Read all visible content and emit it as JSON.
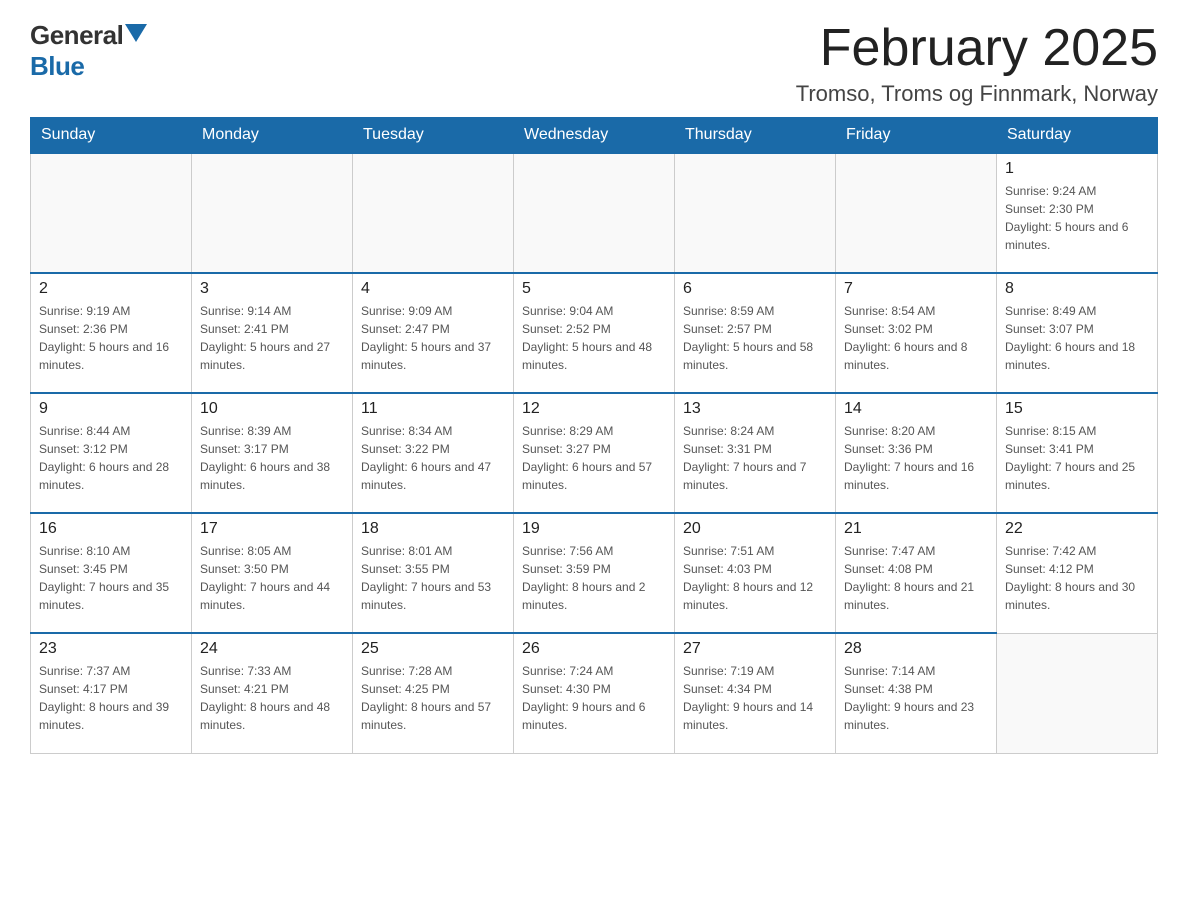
{
  "header": {
    "logo": {
      "general": "General",
      "triangle": "▶",
      "blue": "Blue"
    },
    "title": "February 2025",
    "subtitle": "Tromso, Troms og Finnmark, Norway"
  },
  "weekdays": [
    "Sunday",
    "Monday",
    "Tuesday",
    "Wednesday",
    "Thursday",
    "Friday",
    "Saturday"
  ],
  "weeks": [
    [
      {
        "day": "",
        "info": ""
      },
      {
        "day": "",
        "info": ""
      },
      {
        "day": "",
        "info": ""
      },
      {
        "day": "",
        "info": ""
      },
      {
        "day": "",
        "info": ""
      },
      {
        "day": "",
        "info": ""
      },
      {
        "day": "1",
        "info": "Sunrise: 9:24 AM\nSunset: 2:30 PM\nDaylight: 5 hours and 6 minutes."
      }
    ],
    [
      {
        "day": "2",
        "info": "Sunrise: 9:19 AM\nSunset: 2:36 PM\nDaylight: 5 hours and 16 minutes."
      },
      {
        "day": "3",
        "info": "Sunrise: 9:14 AM\nSunset: 2:41 PM\nDaylight: 5 hours and 27 minutes."
      },
      {
        "day": "4",
        "info": "Sunrise: 9:09 AM\nSunset: 2:47 PM\nDaylight: 5 hours and 37 minutes."
      },
      {
        "day": "5",
        "info": "Sunrise: 9:04 AM\nSunset: 2:52 PM\nDaylight: 5 hours and 48 minutes."
      },
      {
        "day": "6",
        "info": "Sunrise: 8:59 AM\nSunset: 2:57 PM\nDaylight: 5 hours and 58 minutes."
      },
      {
        "day": "7",
        "info": "Sunrise: 8:54 AM\nSunset: 3:02 PM\nDaylight: 6 hours and 8 minutes."
      },
      {
        "day": "8",
        "info": "Sunrise: 8:49 AM\nSunset: 3:07 PM\nDaylight: 6 hours and 18 minutes."
      }
    ],
    [
      {
        "day": "9",
        "info": "Sunrise: 8:44 AM\nSunset: 3:12 PM\nDaylight: 6 hours and 28 minutes."
      },
      {
        "day": "10",
        "info": "Sunrise: 8:39 AM\nSunset: 3:17 PM\nDaylight: 6 hours and 38 minutes."
      },
      {
        "day": "11",
        "info": "Sunrise: 8:34 AM\nSunset: 3:22 PM\nDaylight: 6 hours and 47 minutes."
      },
      {
        "day": "12",
        "info": "Sunrise: 8:29 AM\nSunset: 3:27 PM\nDaylight: 6 hours and 57 minutes."
      },
      {
        "day": "13",
        "info": "Sunrise: 8:24 AM\nSunset: 3:31 PM\nDaylight: 7 hours and 7 minutes."
      },
      {
        "day": "14",
        "info": "Sunrise: 8:20 AM\nSunset: 3:36 PM\nDaylight: 7 hours and 16 minutes."
      },
      {
        "day": "15",
        "info": "Sunrise: 8:15 AM\nSunset: 3:41 PM\nDaylight: 7 hours and 25 minutes."
      }
    ],
    [
      {
        "day": "16",
        "info": "Sunrise: 8:10 AM\nSunset: 3:45 PM\nDaylight: 7 hours and 35 minutes."
      },
      {
        "day": "17",
        "info": "Sunrise: 8:05 AM\nSunset: 3:50 PM\nDaylight: 7 hours and 44 minutes."
      },
      {
        "day": "18",
        "info": "Sunrise: 8:01 AM\nSunset: 3:55 PM\nDaylight: 7 hours and 53 minutes."
      },
      {
        "day": "19",
        "info": "Sunrise: 7:56 AM\nSunset: 3:59 PM\nDaylight: 8 hours and 2 minutes."
      },
      {
        "day": "20",
        "info": "Sunrise: 7:51 AM\nSunset: 4:03 PM\nDaylight: 8 hours and 12 minutes."
      },
      {
        "day": "21",
        "info": "Sunrise: 7:47 AM\nSunset: 4:08 PM\nDaylight: 8 hours and 21 minutes."
      },
      {
        "day": "22",
        "info": "Sunrise: 7:42 AM\nSunset: 4:12 PM\nDaylight: 8 hours and 30 minutes."
      }
    ],
    [
      {
        "day": "23",
        "info": "Sunrise: 7:37 AM\nSunset: 4:17 PM\nDaylight: 8 hours and 39 minutes."
      },
      {
        "day": "24",
        "info": "Sunrise: 7:33 AM\nSunset: 4:21 PM\nDaylight: 8 hours and 48 minutes."
      },
      {
        "day": "25",
        "info": "Sunrise: 7:28 AM\nSunset: 4:25 PM\nDaylight: 8 hours and 57 minutes."
      },
      {
        "day": "26",
        "info": "Sunrise: 7:24 AM\nSunset: 4:30 PM\nDaylight: 9 hours and 6 minutes."
      },
      {
        "day": "27",
        "info": "Sunrise: 7:19 AM\nSunset: 4:34 PM\nDaylight: 9 hours and 14 minutes."
      },
      {
        "day": "28",
        "info": "Sunrise: 7:14 AM\nSunset: 4:38 PM\nDaylight: 9 hours and 23 minutes."
      },
      {
        "day": "",
        "info": ""
      }
    ]
  ]
}
